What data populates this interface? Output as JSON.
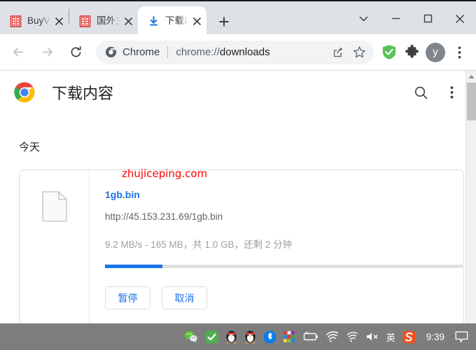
{
  "window": {
    "controls": {
      "tab_search": "tab-search-chevron",
      "minimize": "minimize",
      "maximize": "maximize",
      "close": "close"
    }
  },
  "tabstrip": {
    "tabs": [
      {
        "title": "BuyVM",
        "favicon": "red-seal-favicon",
        "active": false,
        "close_label": "×"
      },
      {
        "title": "国外主",
        "favicon": "red-seal-favicon",
        "active": false,
        "close_label": "×"
      },
      {
        "title": "下载内",
        "favicon": "download-blue-icon",
        "active": true,
        "close_label": "×"
      }
    ],
    "new_tab_label": "+"
  },
  "toolbar": {
    "back": "back-arrow",
    "forward": "forward-arrow",
    "reload": "reload",
    "omnibox": {
      "chip_label": "Chrome",
      "url_scheme": "chrome://",
      "url_path": "downloads",
      "full_url": "chrome://downloads",
      "share_icon": "share",
      "bookmark_icon": "star"
    },
    "extensions": {
      "adguard": "shield-check",
      "puzzle": "puzzle-piece"
    },
    "avatar_letter": "y",
    "menu": "three-dot-menu"
  },
  "downloads_page": {
    "header": {
      "title": "下载内容",
      "logo": "chrome-logo",
      "search_icon": "search",
      "menu_icon": "three-dot-menu"
    },
    "day_label": "今天",
    "item": {
      "file_icon": "generic-file",
      "file_name": "1gb.bin",
      "url": "http://45.153.231.69/1gb.bin",
      "status": "9.2 MB/s - 165 MB，共 1.0 GB，还剩 2 分钟",
      "speed": "9.2 MB/s",
      "downloaded": "165 MB",
      "total_size": "1.0 GB",
      "time_remaining": "2 分钟",
      "progress_percent": 16,
      "buttons": {
        "pause": "暂停",
        "cancel": "取消"
      }
    },
    "watermark": "zhujiceping.com"
  },
  "scrollbar": {
    "up_arrow": "scroll-up-arrow"
  },
  "taskbar": {
    "tray": [
      {
        "name": "wechat-icon",
        "label": ""
      },
      {
        "name": "green-check-icon",
        "label": ""
      },
      {
        "name": "qq-penguin-icon",
        "label": ""
      },
      {
        "name": "qq-penguin-icon-2",
        "label": ""
      },
      {
        "name": "bluetooth-icon",
        "label": ""
      },
      {
        "name": "color-squares-icon",
        "label": ""
      },
      {
        "name": "battery-icon",
        "label": ""
      },
      {
        "name": "wifi-icon",
        "label": ""
      },
      {
        "name": "wifi-signal-icon",
        "label": ""
      },
      {
        "name": "speaker-muted-icon",
        "label": ""
      }
    ],
    "ime_label": "英",
    "sogou_label": "S",
    "clock": "9:39",
    "notification_icon": "notification-bubble"
  },
  "colors": {
    "accent_blue": "#1a73e8",
    "tabstrip_bg": "#dee1e6",
    "watermark_red": "#ff0000",
    "taskbar_bg": "#7d7d7d",
    "shield_green": "#5ac35a"
  }
}
